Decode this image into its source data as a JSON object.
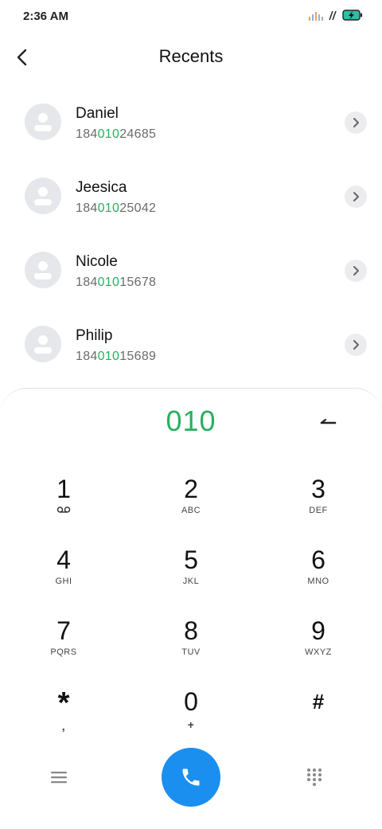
{
  "status_bar": {
    "time": "2:36 AM",
    "icons": [
      "signal-icon",
      "wifi-icon",
      "battery-charging-icon"
    ],
    "battery_color": "#2bc0a6"
  },
  "header": {
    "title": "Recents",
    "back_icon": "back-arrow-icon"
  },
  "recents": [
    {
      "name": "Daniel",
      "number_prefix": "184",
      "number_match": "010",
      "number_suffix": "24685"
    },
    {
      "name": "Jeesica",
      "number_prefix": "184",
      "number_match": "010",
      "number_suffix": "25042"
    },
    {
      "name": "Nicole",
      "number_prefix": "184",
      "number_match": "010",
      "number_suffix": "15678"
    },
    {
      "name": "Philip",
      "number_prefix": "184",
      "number_match": "010",
      "number_suffix": "15689"
    }
  ],
  "dialer": {
    "entered_number": "010",
    "accent_color": "#27b05e",
    "keys": [
      {
        "digit": "1",
        "letters": "",
        "icon": "voicemail-icon"
      },
      {
        "digit": "2",
        "letters": "ABC"
      },
      {
        "digit": "3",
        "letters": "DEF"
      },
      {
        "digit": "4",
        "letters": "GHI"
      },
      {
        "digit": "5",
        "letters": "JKL"
      },
      {
        "digit": "6",
        "letters": "MNO"
      },
      {
        "digit": "7",
        "letters": "PQRS"
      },
      {
        "digit": "8",
        "letters": "TUV"
      },
      {
        "digit": "9",
        "letters": "WXYZ"
      },
      {
        "digit": "*",
        "letters": ","
      },
      {
        "digit": "0",
        "letters": "+"
      },
      {
        "digit": "#",
        "letters": ""
      }
    ]
  },
  "bottom_bar": {
    "menu_icon": "menu-icon",
    "call_icon": "phone-icon",
    "call_color": "#1a8ff0",
    "keypad_icon": "dialpad-icon"
  }
}
